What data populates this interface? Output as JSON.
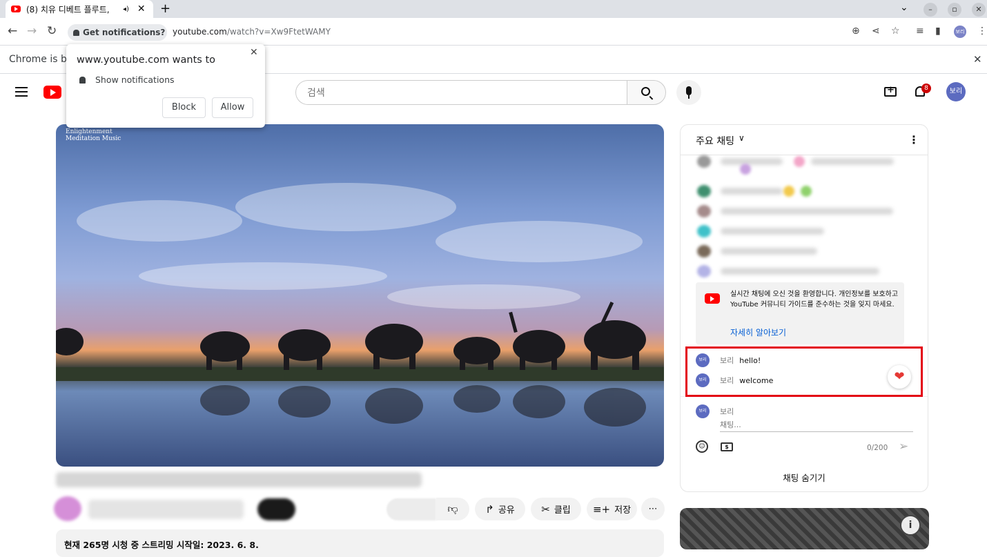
{
  "browser": {
    "tab_title": "(8) 치유 디베트 플루트,",
    "tab_audio_icon": "speaker-icon",
    "url_domain": "youtube.com",
    "url_path": "/watch?v=Xw9FtetWAMY",
    "permission_chip": "Get notifications?",
    "infobar_text": "Chrome is be",
    "profile_initials": "보리"
  },
  "notification_popup": {
    "title": "www.youtube.com wants to",
    "item": "Show notifications",
    "block": "Block",
    "allow": "Allow"
  },
  "youtube": {
    "search_placeholder": "검색",
    "notification_count": "8",
    "avatar_initials": "보리"
  },
  "video": {
    "watermark_line1": "Enlightenment",
    "watermark_line2": "Meditation Music",
    "actions": {
      "share": "공유",
      "clip": "클립",
      "save": "저장",
      "more": "⋯"
    },
    "description": "현재 265명 시청 중 스트리밍 시작일: 2023. 6. 8."
  },
  "chat": {
    "title": "주요 채팅",
    "welcome_text": "실시간 채팅에 오신 것을 환영합니다. 개인정보를 보호하고 YouTube 커뮤니티 가이드를 준수하는 것을 잊지 마세요.",
    "learn_more": "자세히 알아보기",
    "messages": [
      {
        "avatar": "보리",
        "author": "보리",
        "text": "hello!"
      },
      {
        "avatar": "보리",
        "author": "보리",
        "text": "welcome"
      }
    ],
    "input_author": "보리",
    "input_placeholder": "채팅...",
    "char_count": "0/200",
    "hide_chat": "채팅 숨기기"
  },
  "colors": {
    "youtube_red": "#ff0000",
    "highlight_red": "#e30012",
    "link_blue": "#065fd4"
  }
}
